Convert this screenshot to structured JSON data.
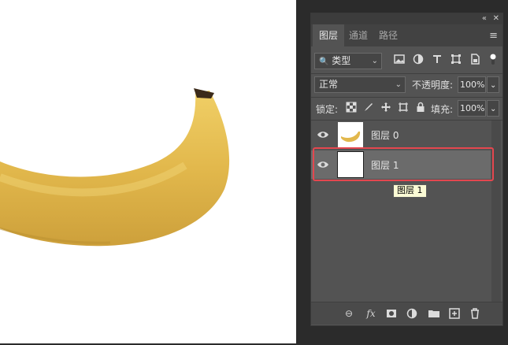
{
  "panel": {
    "controls": {
      "collapse": "«",
      "close": "✕"
    },
    "tabs": [
      {
        "label": "图层",
        "active": true
      },
      {
        "label": "通道",
        "active": false
      },
      {
        "label": "路径",
        "active": false
      }
    ],
    "filter": {
      "label": "类型"
    },
    "blend_mode": "正常",
    "opacity_label": "不透明度:",
    "opacity_value": "100%",
    "lock_label": "锁定:",
    "fill_label": "填充:",
    "fill_value": "100%",
    "layers": [
      {
        "name": "图层 0",
        "visible": true,
        "selected": false
      },
      {
        "name": "图层 1",
        "visible": true,
        "selected": true
      }
    ],
    "tooltip": "图层 1"
  },
  "colors": {
    "accent_highlight": "#e4474f",
    "panel_bg": "#535353",
    "banana": "#e6be4d"
  },
  "icons": {
    "filter": [
      "image-filter-icon",
      "adjustment-filter-icon",
      "type-filter-icon",
      "shape-filter-icon",
      "smart-object-filter-icon",
      "filter-toggle-icon"
    ],
    "lock": [
      "lock-transparent-pixels-icon",
      "lock-image-pixels-icon",
      "lock-position-icon",
      "lock-artboard-icon",
      "lock-all-icon"
    ],
    "footer": [
      "link-layers-icon",
      "fx-icon",
      "add-mask-icon",
      "adjustment-layer-icon",
      "new-group-icon",
      "new-layer-icon",
      "delete-layer-icon"
    ]
  }
}
